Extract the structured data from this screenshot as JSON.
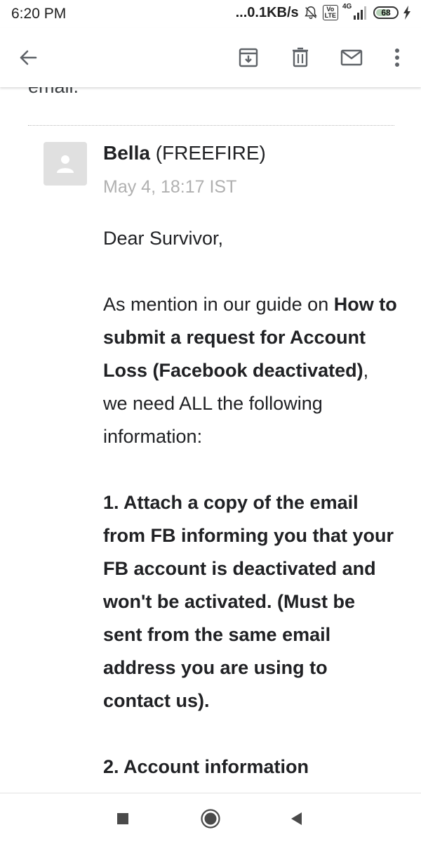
{
  "status_bar": {
    "time": "6:20 PM",
    "net_speed": "...0.1KB/s",
    "volte_label": "Vo\nLTE",
    "network_label": "4G",
    "battery_level": "68",
    "battery_fraction": 0.68,
    "icons": [
      "alarm-off-icon",
      "volte-icon",
      "signal-icon",
      "battery-icon",
      "charging-bolt-icon"
    ]
  },
  "toolbar": {
    "icons": [
      "back-arrow-icon",
      "archive-icon",
      "delete-icon",
      "mail-icon",
      "overflow-menu-icon"
    ]
  },
  "thread": {
    "previous_tail": "email."
  },
  "message": {
    "sender_name": "Bella",
    "sender_org": "(FREEFIRE)",
    "date": "May 4, 18:17 IST",
    "greeting": "Dear Survivor,",
    "intro_plain_1": "As mention in our guide on ",
    "intro_bold": "How to submit a request for Account Loss (Facebook deactivated)",
    "intro_plain_2": ", we need ALL the following information:",
    "item_1": "1. Attach a copy of the email from FB informing you that your FB account is deactivated and won't be activated. (Must be sent from the same email address you are using to contact us).",
    "item_2": "2. Account information"
  },
  "nav": {
    "icons": [
      "recents-icon",
      "home-icon",
      "back-icon"
    ]
  },
  "colors": {
    "accent_text": "#202124",
    "muted_text": "#b0b0b0",
    "icon_gray": "#5f6368",
    "battery_green": "#2e7d32"
  }
}
